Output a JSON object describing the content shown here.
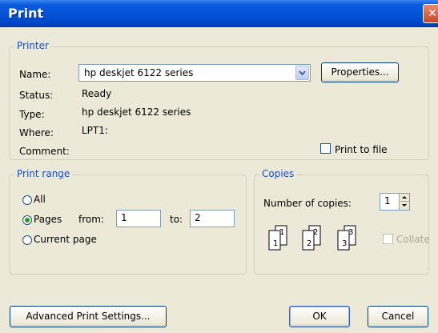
{
  "window": {
    "title": "Print",
    "close_glyph": "✕"
  },
  "printer": {
    "group_label": "Printer",
    "name_label": "Name:",
    "name_value": "hp deskjet 6122 series",
    "properties_button": "Properties...",
    "status_label": "Status:",
    "status_value": "Ready",
    "type_label": "Type:",
    "type_value": "hp deskjet 6122 series",
    "where_label": "Where:",
    "where_value": "LPT1:",
    "comment_label": "Comment:",
    "comment_value": "",
    "print_to_file_label": "Print to file",
    "print_to_file_checked": false
  },
  "print_range": {
    "group_label": "Print range",
    "all_label": "All",
    "pages_label": "Pages",
    "from_label": "from:",
    "from_value": "1",
    "to_label": "to:",
    "to_value": "2",
    "current_page_label": "Current page",
    "selected": "pages"
  },
  "copies": {
    "group_label": "Copies",
    "number_label": "Number of copies:",
    "number_value": "1",
    "collate_label": "Collate",
    "collate_enabled": false,
    "page_digits": [
      "1",
      "1",
      "2",
      "2",
      "3",
      "3"
    ]
  },
  "buttons": {
    "advanced": "Advanced Print Settings...",
    "ok": "OK",
    "cancel": "Cancel"
  },
  "colors": {
    "titlebar": "#0553d8",
    "group_label": "#1a4ec0",
    "dialog_bg": "#ece9d8"
  }
}
